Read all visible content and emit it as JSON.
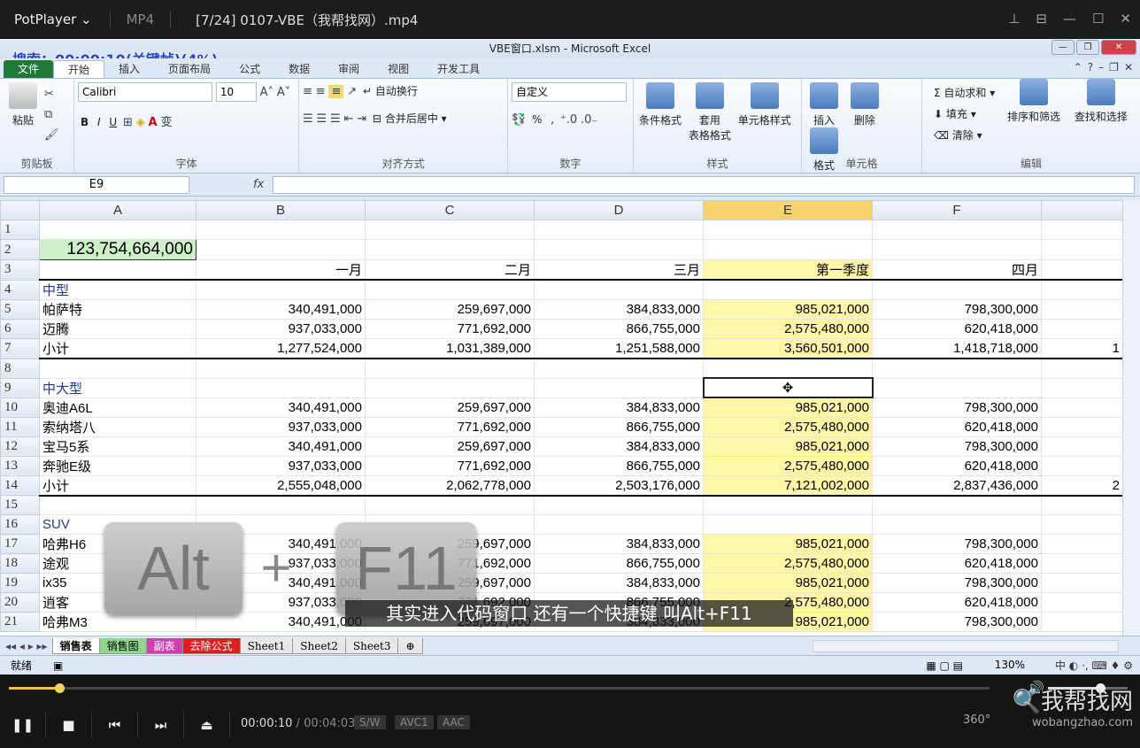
{
  "player": {
    "app_name": "PotPlayer",
    "format": "MP4",
    "title": "[7/24] 0107-VBE（我帮找网）.mp4",
    "search_overlay": "搜索：00:00:10(关键帧)(4%)",
    "current_time": "00:00:10",
    "time_sep": "/",
    "duration": "00:04:03",
    "tags": [
      "S/W",
      "AVC1",
      "AAC"
    ],
    "progress_fraction": 0.04,
    "watermark_line1": "我帮找网",
    "watermark_line2": "wobangzhao.com",
    "subtitle": "其实进入代码窗口 还有一个快捷键 叫Alt+F11"
  },
  "excel": {
    "window_title": "VBE窗口.xlsm - Microsoft Excel",
    "tabs": [
      "文件",
      "开始",
      "插入",
      "页面布局",
      "公式",
      "数据",
      "审阅",
      "视图",
      "开发工具"
    ],
    "ribbon": {
      "clipboard": {
        "paste": "粘贴",
        "group": "剪贴板"
      },
      "font": {
        "name": "Calibri",
        "size": "10",
        "bold": "B",
        "italic": "I",
        "underline": "U",
        "group": "字体"
      },
      "align": {
        "wrap": "自动换行",
        "merge": "合并后居中",
        "group": "对齐方式"
      },
      "number": {
        "format": "自定义",
        "group": "数字",
        "percent": "%",
        "comma": ","
      },
      "styles": {
        "cond": "条件格式",
        "table": "套用\n表格格式",
        "table1": "套用",
        "table2": "表格格式",
        "cell": "单元格样式",
        "group": "样式"
      },
      "cells": {
        "insert": "插入",
        "delete": "删除",
        "format": "格式",
        "group": "单元格"
      },
      "edit": {
        "autosum": "自动求和",
        "fill": "填充",
        "clear": "清除",
        "sort": "排序和筛选",
        "find": "查找和选择",
        "group": "编辑"
      }
    },
    "name_box": "E9",
    "fx": "fx",
    "columns": [
      "A",
      "B",
      "C",
      "D",
      "E",
      "F"
    ],
    "rows": [
      {
        "n": "1",
        "a": "",
        "b": "",
        "c": "",
        "d": "",
        "e": "",
        "f": ""
      },
      {
        "n": "2",
        "a": "123,754,664,000",
        "b": "",
        "c": "",
        "d": "",
        "e": "",
        "f": ""
      },
      {
        "n": "3",
        "a": "",
        "b": "一月",
        "c": "二月",
        "d": "三月",
        "e": "第一季度",
        "f": "四月"
      },
      {
        "n": "4",
        "a": "中型",
        "b": "",
        "c": "",
        "d": "",
        "e": "",
        "f": ""
      },
      {
        "n": "5",
        "a": "帕萨特",
        "b": "340,491,000",
        "c": "259,697,000",
        "d": "384,833,000",
        "e": "985,021,000",
        "f": "798,300,000"
      },
      {
        "n": "6",
        "a": "迈腾",
        "b": "937,033,000",
        "c": "771,692,000",
        "d": "866,755,000",
        "e": "2,575,480,000",
        "f": "620,418,000"
      },
      {
        "n": "7",
        "a": "小计",
        "b": "1,277,524,000",
        "c": "1,031,389,000",
        "d": "1,251,588,000",
        "e": "3,560,501,000",
        "f": "1,418,718,000"
      },
      {
        "n": "8",
        "a": "",
        "b": "",
        "c": "",
        "d": "",
        "e": "",
        "f": ""
      },
      {
        "n": "9",
        "a": "中大型",
        "b": "",
        "c": "",
        "d": "",
        "e": "",
        "f": ""
      },
      {
        "n": "10",
        "a": "奥迪A6L",
        "b": "340,491,000",
        "c": "259,697,000",
        "d": "384,833,000",
        "e": "985,021,000",
        "f": "798,300,000"
      },
      {
        "n": "11",
        "a": "索纳塔八",
        "b": "937,033,000",
        "c": "771,692,000",
        "d": "866,755,000",
        "e": "2,575,480,000",
        "f": "620,418,000"
      },
      {
        "n": "12",
        "a": "宝马5系",
        "b": "340,491,000",
        "c": "259,697,000",
        "d": "384,833,000",
        "e": "985,021,000",
        "f": "798,300,000"
      },
      {
        "n": "13",
        "a": "奔驰E级",
        "b": "937,033,000",
        "c": "771,692,000",
        "d": "866,755,000",
        "e": "2,575,480,000",
        "f": "620,418,000"
      },
      {
        "n": "14",
        "a": "小计",
        "b": "2,555,048,000",
        "c": "2,062,778,000",
        "d": "2,503,176,000",
        "e": "7,121,002,000",
        "f": "2,837,436,000"
      },
      {
        "n": "15",
        "a": "",
        "b": "",
        "c": "",
        "d": "",
        "e": "",
        "f": ""
      },
      {
        "n": "16",
        "a": "SUV",
        "b": "",
        "c": "",
        "d": "",
        "e": "",
        "f": ""
      },
      {
        "n": "17",
        "a": "哈弗H6",
        "b": "340,491,000",
        "c": "259,697,000",
        "d": "384,833,000",
        "e": "985,021,000",
        "f": "798,300,000"
      },
      {
        "n": "18",
        "a": "途观",
        "b": "937,033,000",
        "c": "771,692,000",
        "d": "866,755,000",
        "e": "2,575,480,000",
        "f": "620,418,000"
      },
      {
        "n": "19",
        "a": "ix35",
        "b": "340,491,000",
        "c": "259,697,000",
        "d": "384,833,000",
        "e": "985,021,000",
        "f": "798,300,000"
      },
      {
        "n": "20",
        "a": "逍客",
        "b": "937,033,000",
        "c": "771,692,000",
        "d": "866,755,000",
        "e": "2,575,480,000",
        "f": "620,418,000"
      },
      {
        "n": "21",
        "a": "哈弗M3",
        "b": "340,491,000",
        "c": "259,697,000",
        "d": "384,833,000",
        "e": "985,021,000",
        "f": "798,300,000"
      }
    ],
    "overflow_g7": "1",
    "overflow_g14": "2",
    "sheets": [
      "销售表",
      "销售图",
      "副表",
      "去除公式",
      "Sheet1",
      "Sheet2",
      "Sheet3"
    ],
    "status": "就绪",
    "zoom": "130%"
  },
  "key_overlay": {
    "key1": "Alt",
    "plus": "+",
    "key2": "F11"
  }
}
